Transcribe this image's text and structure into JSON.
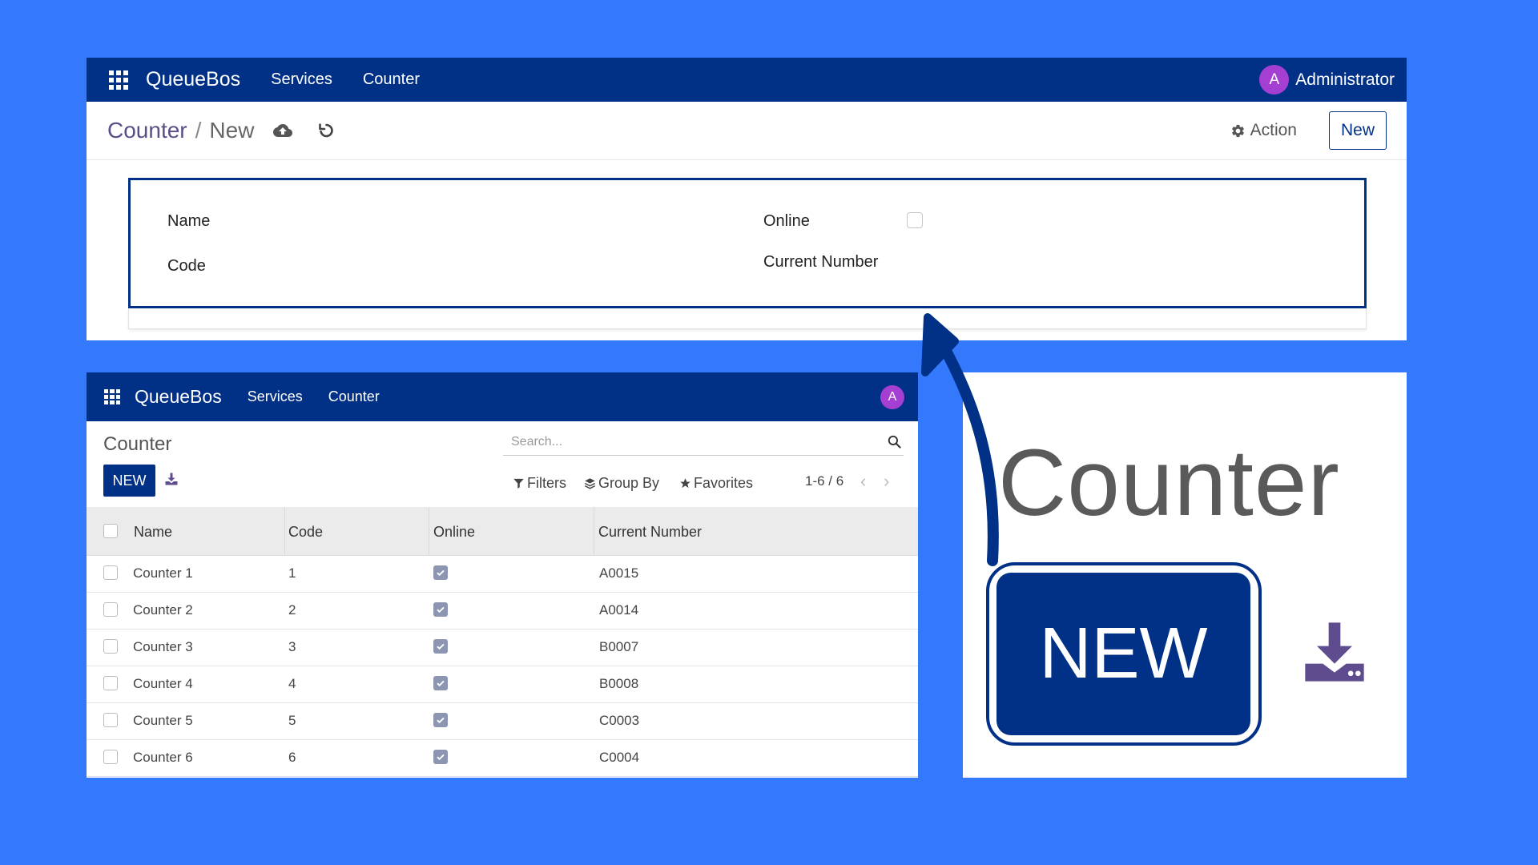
{
  "colors": {
    "background": "#3479fb",
    "navbar": "#013087",
    "avatar": "#a43fd1",
    "highlight": "#013087",
    "checkbox_checked": "#8c95b1"
  },
  "form_view": {
    "navbar": {
      "apps_icon": "apps-grid-icon",
      "brand": "QueueBos",
      "menu": [
        "Services",
        "Counter"
      ],
      "avatar_letter": "A",
      "user_name": "Administrator"
    },
    "breadcrumb": {
      "root": "Counter",
      "separator": "/",
      "current": "New"
    },
    "icons": {
      "save": "cloud-upload-icon",
      "discard": "undo-icon",
      "action": "gear-icon"
    },
    "action_label": "Action",
    "new_label": "New",
    "fields": {
      "name_label": "Name",
      "code_label": "Code",
      "online_label": "Online",
      "online_checked": false,
      "current_number_label": "Current Number"
    }
  },
  "list_view": {
    "navbar": {
      "brand": "QueueBos",
      "menu": [
        "Services",
        "Counter"
      ],
      "avatar_letter": "A"
    },
    "title": "Counter",
    "search_placeholder": "Search...",
    "new_label": "NEW",
    "filters": {
      "filters_label": "Filters",
      "group_by_label": "Group By",
      "favorites_label": "Favorites"
    },
    "pager": "1-6 / 6",
    "pager_prev": "‹",
    "pager_next": "›",
    "columns": [
      "Name",
      "Code",
      "Online",
      "Current Number"
    ],
    "rows": [
      {
        "name": "Counter 1",
        "code": "1",
        "online": true,
        "current_number": "A0015"
      },
      {
        "name": "Counter 2",
        "code": "2",
        "online": true,
        "current_number": "A0014"
      },
      {
        "name": "Counter 3",
        "code": "3",
        "online": true,
        "current_number": "B0007"
      },
      {
        "name": "Counter 4",
        "code": "4",
        "online": true,
        "current_number": "B0008"
      },
      {
        "name": "Counter 5",
        "code": "5",
        "online": true,
        "current_number": "C0003"
      },
      {
        "name": "Counter 6",
        "code": "6",
        "online": true,
        "current_number": "C0004"
      }
    ]
  },
  "zoom_view": {
    "title": "Counter",
    "new_label": "NEW",
    "download_icon": "download-icon"
  }
}
